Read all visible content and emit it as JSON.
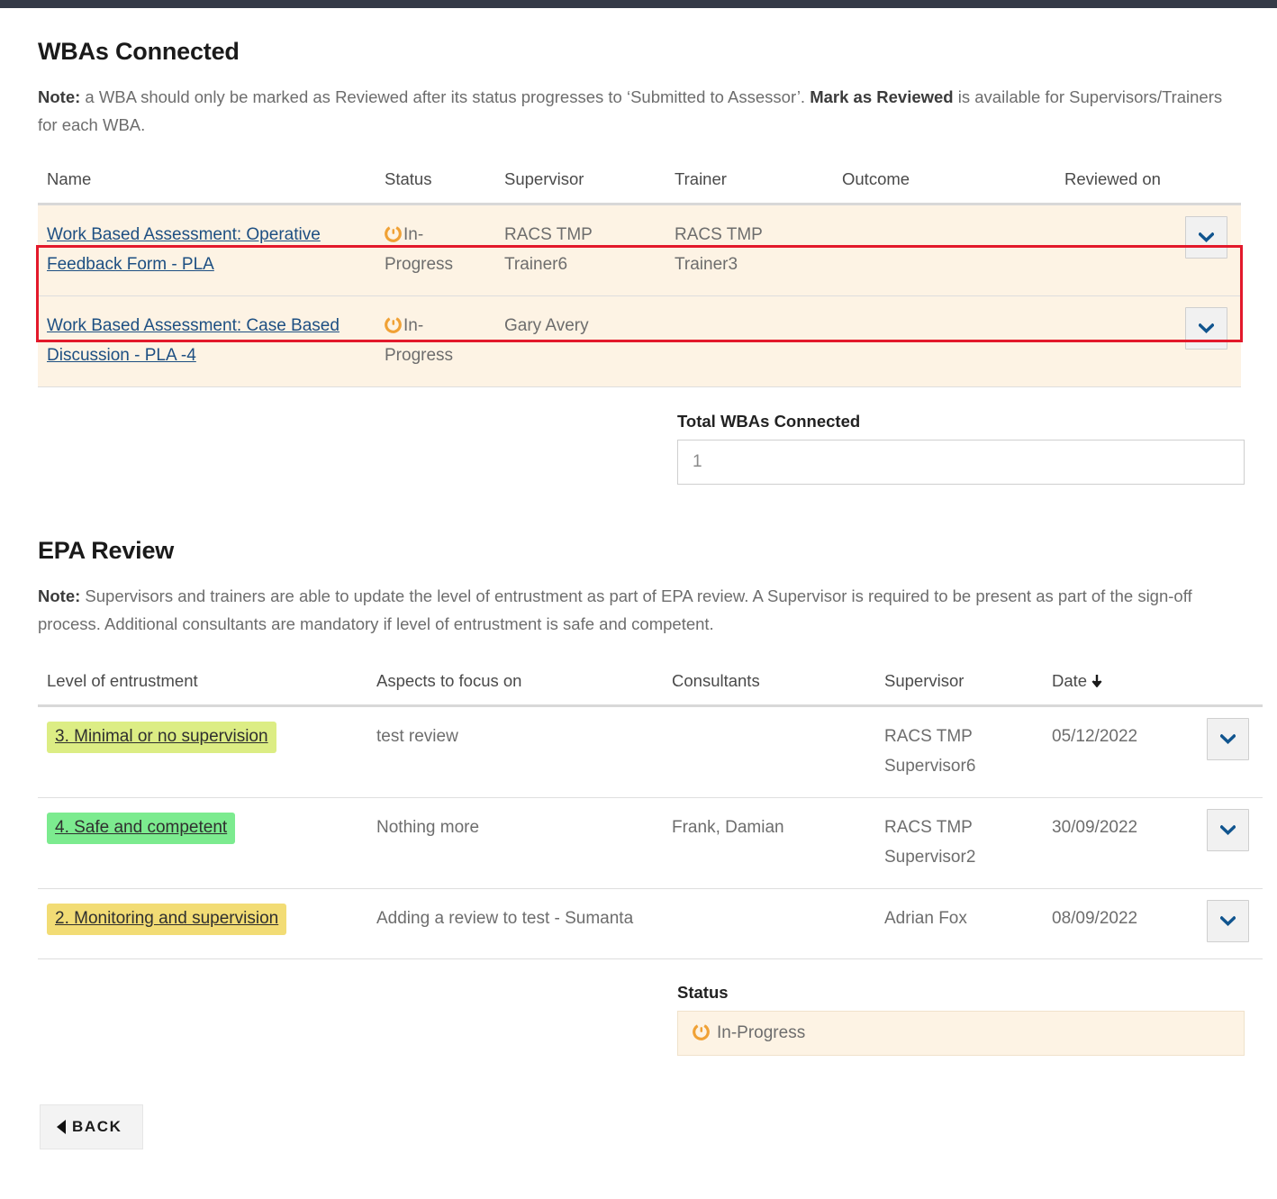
{
  "wba_section": {
    "title": "WBAs Connected",
    "note_prefix": "Note:",
    "note_part1": " a WBA should only be marked as Reviewed after its status progresses to ‘Submitted to Assessor’. ",
    "note_bold": "Mark as Reviewed",
    "note_part2": " is available for Supervisors/Trainers for each WBA.",
    "columns": [
      "Name",
      "Status",
      "Supervisor",
      "Trainer",
      "Outcome",
      "Reviewed on"
    ],
    "rows": [
      {
        "name": "Work Based Assessment: Operative Feedback Form - PLA",
        "status": "In-Progress",
        "status_icon": "in-progress-icon",
        "supervisor": "RACS TMP Trainer6",
        "trainer": "RACS TMP Trainer3",
        "outcome": "",
        "reviewed_on": "",
        "highlighted": false
      },
      {
        "name": "Work Based Assessment: Case Based Discussion - PLA -4",
        "status": "In-Progress",
        "status_icon": "in-progress-icon",
        "supervisor": "Gary Avery",
        "trainer": "",
        "outcome": "",
        "reviewed_on": "",
        "highlighted": true
      }
    ],
    "total_label": "Total WBAs Connected",
    "total_value": "1"
  },
  "epa_section": {
    "title": "EPA Review",
    "note_prefix": "Note:",
    "note_text": " Supervisors and trainers are able to update the level of entrustment as part of EPA review. A Supervisor is required to be present as part of the sign-off process. Additional consultants are mandatory if level of entrustment is safe and competent.",
    "columns": [
      "Level of entrustment",
      "Aspects to focus on",
      "Consultants",
      "Supervisor",
      "Date"
    ],
    "sort_column": "Date",
    "sort_direction": "desc",
    "rows": [
      {
        "level": "3. Minimal or no supervision",
        "level_color": "#dced84",
        "aspects": "test review",
        "consultants": "",
        "supervisor": "RACS TMP Supervisor6",
        "date": "05/12/2022"
      },
      {
        "level": "4. Safe and competent",
        "level_color": "#7ceb8f",
        "aspects": "Nothing more",
        "consultants": "Frank, Damian",
        "supervisor": "RACS TMP Supervisor2",
        "date": "30/09/2022"
      },
      {
        "level": "2. Monitoring and supervision",
        "level_color": "#f2dc75",
        "aspects": "Adding a review to test - Sumanta",
        "consultants": "",
        "supervisor": "Adrian Fox",
        "date": "08/09/2022"
      }
    ],
    "status_label": "Status",
    "status_value": "In-Progress",
    "status_icon": "in-progress-icon"
  },
  "footer": {
    "back_label": "BACK",
    "back_icon": "triangle-left-icon"
  },
  "colors": {
    "accent_link": "#1d4f82",
    "status_orange": "#f0a135",
    "row_cream": "#fdf3e4",
    "highlight_red": "#e3192b",
    "topbar": "#343a47"
  }
}
